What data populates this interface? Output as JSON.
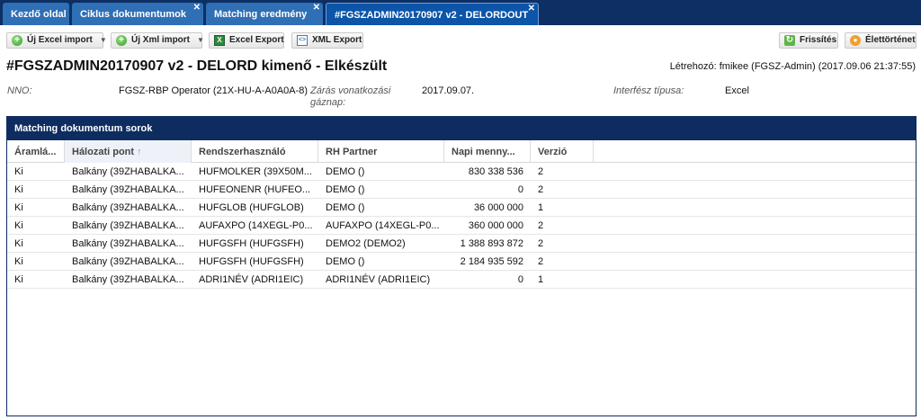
{
  "tabs": [
    {
      "label": "Kezdő oldal",
      "closable": false,
      "active": false
    },
    {
      "label": "Ciklus dokumentumok",
      "closable": true,
      "active": false
    },
    {
      "label": "Matching eredmény",
      "closable": true,
      "active": false
    },
    {
      "label": "#FGSZADMIN20170907 v2 - DELORDOUT",
      "closable": true,
      "active": true
    }
  ],
  "toolbar": {
    "excel_import": "Új Excel import",
    "xml_import": "Új Xml import",
    "excel_export": "Excel Export",
    "xml_export": "XML Export",
    "refresh": "Frissítés",
    "history": "Élettörténet"
  },
  "header": {
    "title": "#FGSZADMIN20170907 v2 - DELORD kimenő - Elkészült",
    "creator": "Létrehozó: fmikee (FGSZ-Admin) (2017.09.06 21:37:55)"
  },
  "info": {
    "nno_label": "NNO:",
    "nno_value": "FGSZ-RBP Operator (21X-HU-A-A0A0A-8)",
    "gasday_label_1": "Zárás vonatkozási",
    "gasday_label_2": "gáznap:",
    "gasday_value": "2017.09.07.",
    "interface_label": "Interfész típusa:",
    "interface_value": "Excel"
  },
  "panel": {
    "title": "Matching dokumentum sorok",
    "columns": [
      "Áramlá...",
      "Hálozati pont",
      "Rendszerhasználó",
      "RH Partner",
      "Napi menny...",
      "Verzió"
    ],
    "rows": [
      [
        "Ki",
        "Balkány (39ZHABALKA...",
        "HUFMOLKER (39X50M...",
        "DEMO ()",
        "830 338 536",
        "2"
      ],
      [
        "Ki",
        "Balkány (39ZHABALKA...",
        "HUFEONENR (HUFEO...",
        "DEMO ()",
        "0",
        "2"
      ],
      [
        "Ki",
        "Balkány (39ZHABALKA...",
        "HUFGLOB (HUFGLOB)",
        "DEMO ()",
        "36 000 000",
        "1"
      ],
      [
        "Ki",
        "Balkány (39ZHABALKA...",
        "AUFAXPO (14XEGL-P0...",
        "AUFAXPO (14XEGL-P0...",
        "360 000 000",
        "2"
      ],
      [
        "Ki",
        "Balkány (39ZHABALKA...",
        "HUFGSFH (HUFGSFH)",
        "DEMO2 (DEMO2)",
        "1 388 893 872",
        "2"
      ],
      [
        "Ki",
        "Balkány (39ZHABALKA...",
        "HUFGSFH (HUFGSFH)",
        "DEMO ()",
        "2 184 935 592",
        "2"
      ],
      [
        "Ki",
        "Balkány (39ZHABALKA...",
        "ADRI1NÉV (ADRI1EIC)",
        "ADRI1NÉV (ADRI1EIC)",
        "0",
        "1"
      ]
    ]
  }
}
